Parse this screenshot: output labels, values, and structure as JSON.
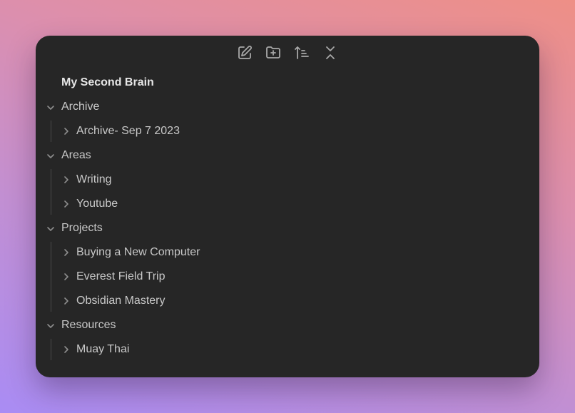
{
  "toolbar": {
    "buttons": [
      {
        "icon": "new-note-icon"
      },
      {
        "icon": "new-folder-icon"
      },
      {
        "icon": "sort-icon"
      },
      {
        "icon": "collapse-all-icon"
      }
    ]
  },
  "vault": {
    "title": "My Second Brain"
  },
  "tree": {
    "folders": [
      {
        "label": "Archive",
        "expanded": true,
        "children": [
          "Archive- Sep 7 2023"
        ]
      },
      {
        "label": "Areas",
        "expanded": true,
        "children": [
          "Writing",
          "Youtube"
        ]
      },
      {
        "label": "Projects",
        "expanded": true,
        "children": [
          "Buying a New Computer",
          "Everest Field Trip",
          "Obsidian Mastery"
        ]
      },
      {
        "label": "Resources",
        "expanded": true,
        "children": [
          "Muay Thai"
        ]
      }
    ]
  },
  "colors": {
    "panel": "#262626",
    "text": "#c8c8c8",
    "title": "#e6e6e6",
    "icon": "#a8a8a8"
  }
}
